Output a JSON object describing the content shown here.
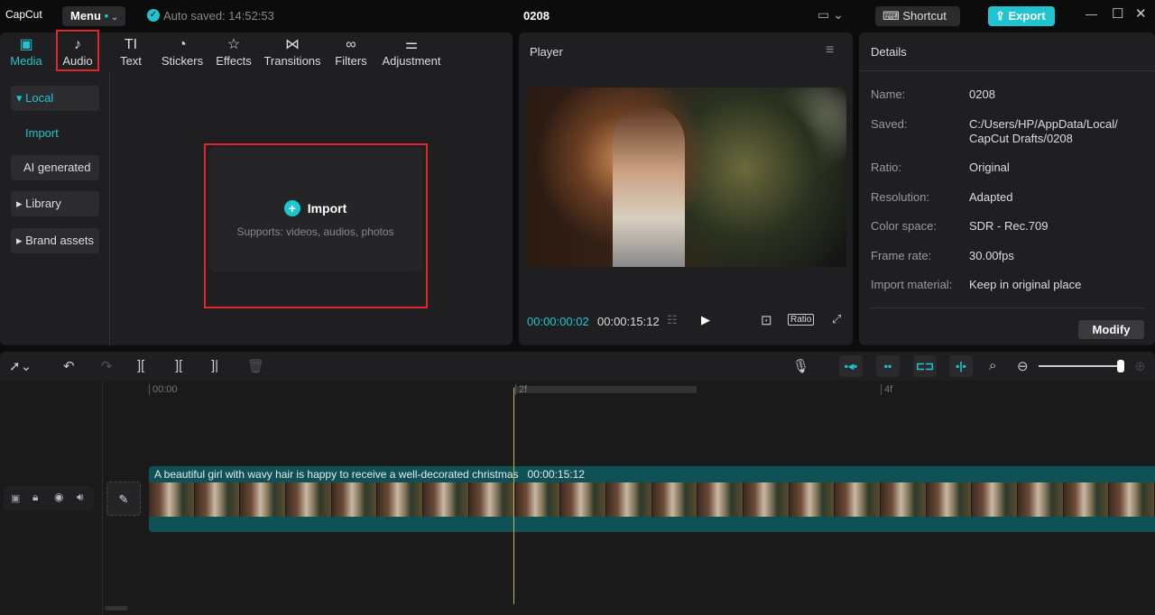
{
  "app": {
    "logo": "CapCut",
    "menu": "Menu",
    "autosave": "Auto saved: 14:52:53",
    "project": "0208",
    "shortcut": "Shortcut",
    "export": "Export"
  },
  "tabs": [
    {
      "label": "Media",
      "icon": "media-icon"
    },
    {
      "label": "Audio",
      "icon": "music-note-icon"
    },
    {
      "label": "Text",
      "icon": "text-icon"
    },
    {
      "label": "Stickers",
      "icon": "sticker-icon"
    },
    {
      "label": "Effects",
      "icon": "star-icon"
    },
    {
      "label": "Transitions",
      "icon": "bowtie-icon"
    },
    {
      "label": "Filters",
      "icon": "circles-icon"
    },
    {
      "label": "Adjustment",
      "icon": "sliders-icon"
    }
  ],
  "sidebar": {
    "local": "Local",
    "import": "Import",
    "ai": "AI generated",
    "library": "Library",
    "brand": "Brand assets"
  },
  "import": {
    "label": "Import",
    "hint": "Supports: videos, audios, photos"
  },
  "player": {
    "title": "Player",
    "current": "00:00:00:02",
    "total": "00:00:15:12",
    "ratio": "Ratio"
  },
  "details": {
    "title": "Details",
    "rows": [
      {
        "k": "Name:",
        "v": "0208"
      },
      {
        "k": "Saved:",
        "v": "C:/Users/HP/AppData/Local/ CapCut Drafts/0208"
      },
      {
        "k": "Ratio:",
        "v": "Original"
      },
      {
        "k": "Resolution:",
        "v": "Adapted"
      },
      {
        "k": "Color space:",
        "v": "SDR - Rec.709"
      },
      {
        "k": "Frame rate:",
        "v": "30.00fps"
      },
      {
        "k": "Import material:",
        "v": "Keep in original place"
      }
    ],
    "modify": "Modify"
  },
  "timeline": {
    "ticks": [
      "00:00",
      "2f",
      "4f"
    ],
    "clip_title": "A beautiful girl with wavy hair is happy to receive a well-decorated christmas",
    "clip_duration": "00:00:15:12",
    "zoom_level": 0.97
  },
  "colors": {
    "accent": "#1ec5d0",
    "highlight": "#e0262b",
    "clip": "#0e5257"
  }
}
